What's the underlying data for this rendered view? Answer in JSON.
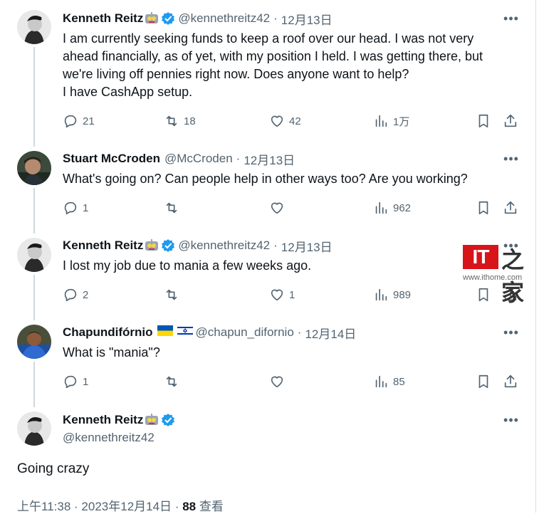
{
  "tweets": [
    {
      "name": "Kenneth Reitz",
      "handle": "@kennethreitz42",
      "date": "12月13日",
      "text": "I am currently seeking funds to keep a roof over our head. I was not very\nahead financially, as of yet, with my position I held. I was getting there, but\nwe're living off pennies right now. Does anyone want to help?\nI have CashApp setup.",
      "replies": "21",
      "retweets": "18",
      "likes": "42",
      "views": "1万"
    },
    {
      "name": "Stuart McCroden",
      "handle": "@McCroden",
      "date": "12月13日",
      "text": "What's going on? Can people help in other ways too? Are you working?",
      "replies": "1",
      "retweets": "",
      "likes": "",
      "views": "962"
    },
    {
      "name": "Kenneth Reitz",
      "handle": "@kennethreitz42",
      "date": "12月13日",
      "text": "I lost my job due to mania a few weeks ago.",
      "replies": "2",
      "retweets": "",
      "likes": "1",
      "views": "989"
    },
    {
      "name": "Chapundifórnio",
      "handle": "@chapun_difornio",
      "date": "12月14日",
      "text": "What is \"mania\"?",
      "replies": "1",
      "retweets": "",
      "likes": "",
      "views": "85"
    }
  ],
  "main": {
    "name": "Kenneth Reitz",
    "handle": "@kennethreitz42",
    "text": "Going crazy",
    "time": "上午11:38",
    "date": "2023年12月14日",
    "views_count": "88",
    "views_label": "查看"
  },
  "meta_sep": "·",
  "more_label": "•••",
  "watermark": {
    "logo": "IT",
    "zh": "之家",
    "url": "www.ithome.com"
  },
  "colors": {
    "text": "#0f1419",
    "secondary": "#536471",
    "verified": "#1d9bf0",
    "thread_line": "#cfd9de",
    "watermark_red": "#d7141a"
  }
}
